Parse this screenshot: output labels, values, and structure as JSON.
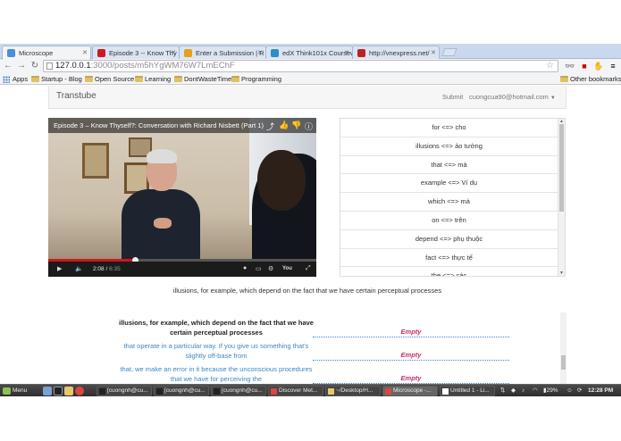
{
  "browser": {
    "tabs": [
      {
        "label": "Microscope",
        "active": true,
        "favicon_color": "#4a90d9"
      },
      {
        "label": "Episode 3 -- Know Thy",
        "active": false,
        "favicon_color": "#cc181e"
      },
      {
        "label": "Enter a Submission | R",
        "active": false,
        "favicon_color": "#e3a21a"
      },
      {
        "label": "edX Think101x Courseware",
        "active": false,
        "favicon_color": "#2b8ec5"
      },
      {
        "label": "http://vnexpress.net/",
        "active": false,
        "favicon_color": "#b22"
      }
    ],
    "url_host": "127.0.0.1",
    "url_path": ":3000/posts/m5hYgWM76W7LmEChF",
    "bookmarks": [
      {
        "label": "Apps",
        "icon": "apps-grid-icon"
      },
      {
        "label": "Startup - Blog",
        "icon": "folder-icon"
      },
      {
        "label": "Open Source",
        "icon": "folder-icon"
      },
      {
        "label": "Learning",
        "icon": "folder-icon"
      },
      {
        "label": "DontWasteTime",
        "icon": "folder-icon"
      },
      {
        "label": "Programming",
        "icon": "folder-icon"
      }
    ],
    "other_bookmarks": "Other bookmarks"
  },
  "app": {
    "brand": "Transtube",
    "nav_submit": "Submit",
    "nav_user": "cuongcua90@hotmail.com"
  },
  "video": {
    "title": "Episode 3 – Know Thyself?: Conversation with Richard Nisbett (Part 1)",
    "current_time": "2:08",
    "duration": "6:35",
    "progress_fraction": 0.324
  },
  "dictionary": [
    "for <=> cho",
    "illusions <=> ảo tưởng",
    "that <=> mà",
    "example <=> Ví dụ",
    "which <=> mà",
    "on <=> trên",
    "depend <=> phụ thuộc",
    "fact <=> thực tế",
    "the <=> các"
  ],
  "current_subtitle": "illusions, for example, which depend on the fact that we have certain perceptual processes",
  "subtitles": [
    {
      "line1": "illusions, for example, which depend on the fact that we have",
      "line2": "certain perceptual processes",
      "style": "bold",
      "translation": "Empty"
    },
    {
      "line1": "that operate in a particular way. If you give us something that's",
      "line2": "slightly off-base from",
      "style": "blue",
      "translation": "Empty"
    },
    {
      "line1": "that, we make an error in it because the unconscious procedures",
      "line2": "that we have for perceiving the",
      "style": "blue",
      "translation": "Empty"
    }
  ],
  "taskbar": {
    "menu": "Menu",
    "tasks": [
      "[cuongnh@cu...",
      "[cuongnh@cu...",
      "[cuongnh@cu...",
      "Discover Met...",
      "~/Desktop/H...",
      "Microscope -...",
      "Untitled 1 - Li..."
    ],
    "battery": "29%",
    "clock": "12:28 PM"
  }
}
